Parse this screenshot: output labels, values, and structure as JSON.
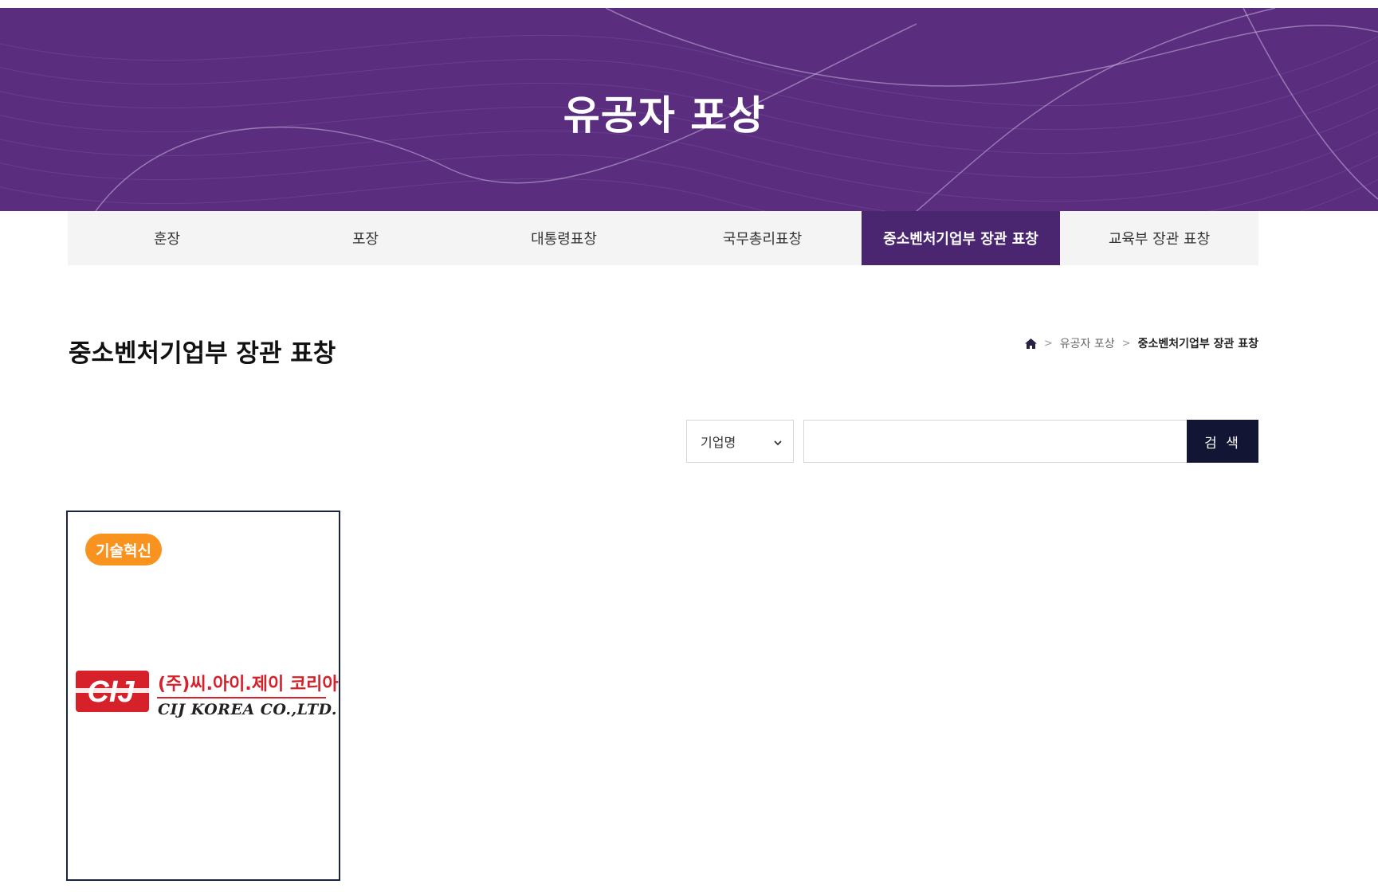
{
  "hero": {
    "title": "유공자 포상"
  },
  "tabs": [
    {
      "label": "훈장",
      "active": false
    },
    {
      "label": "포장",
      "active": false
    },
    {
      "label": "대통령표창",
      "active": false
    },
    {
      "label": "국무총리표창",
      "active": false
    },
    {
      "label": "중소벤처기업부 장관 표창",
      "active": true
    },
    {
      "label": "교육부 장관 표창",
      "active": false
    }
  ],
  "page": {
    "title": "중소벤처기업부 장관 표창"
  },
  "breadcrumb": {
    "home_icon": "home-icon",
    "level1": "유공자 포상",
    "current": "중소벤처기업부 장관 표창"
  },
  "search": {
    "field_selected": "기업명",
    "input_value": "",
    "button_label": "검 색"
  },
  "cards": [
    {
      "badge": "기술혁신",
      "logo": {
        "mark": "CIJ",
        "name_ko": "(주)씨.아이.제이 코리아",
        "name_en": "CIJ KOREA CO.,LTD."
      }
    }
  ],
  "colors": {
    "hero_bg": "#5a2d7f",
    "tab_active": "#4a2670",
    "button": "#121634",
    "badge": "#f7931e",
    "logo_red": "#d6202a"
  }
}
